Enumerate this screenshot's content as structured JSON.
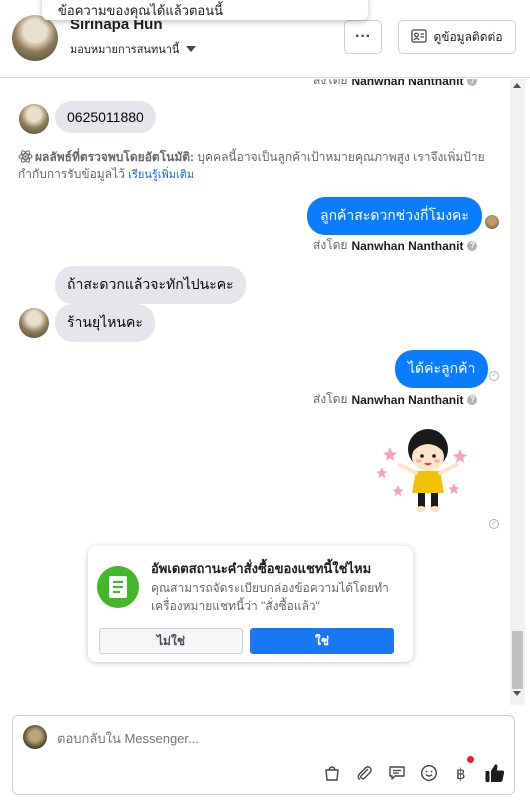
{
  "toast": {
    "text": "ข้อความของคุณได้แล้วตอนนี้"
  },
  "header": {
    "name": "Sirinapa Hun",
    "assign_label": "มอบหมายการสนทนานี้",
    "more_label": "···",
    "contact_button_label": "ดูข้อมูลติดต่อ"
  },
  "messages": {
    "top_sent_by": {
      "prefix": "ส่งโดย",
      "name": "Nanwhan Nanthanit"
    },
    "msg_phone": "0625011880",
    "auto_detect": {
      "label": "ผลลัพธ์ที่ตรวจพบโดยอัตโนมัติ:",
      "text": "บุคคลนี้อาจเป็นลูกค้าเป้าหมายคุณภาพสูง เราจึงเพิ่มป้ายกำกับการรับข้อมูลไว้",
      "link": "เรียนรู้เพิ่มเติม"
    },
    "msg_out_1": "ลูกค้าสะดวกช่วงกี่โมงคะ",
    "sent_by_1": {
      "prefix": "ส่งโดย",
      "name": "Nanwhan Nanthanit"
    },
    "msg_in_2": "ถ้าสะดวกแล้วจะทักไปนะคะ",
    "msg_in_3": "ร้านยุไหนคะ",
    "msg_out_2": "ได้ค่ะลูกค้า",
    "sent_by_2": {
      "prefix": "ส่งโดย",
      "name": "Nanwhan Nanthanit"
    }
  },
  "order_card": {
    "title": "อัพเดตสถานะคำสั่งซื้อของแชทนี้ใช่ไหม",
    "description": "คุณสามารถจัดระเบียบกล่องข้อความได้โดยทำเครื่องหมายแชทนี้ว่า \"สั่งซื้อแล้ว\"",
    "no_label": "ไม่ใช่",
    "yes_label": "ใช่"
  },
  "composer": {
    "placeholder": "ตอบกลับใน Messenger..."
  },
  "colors": {
    "accent": "#0a7cff",
    "button_blue": "#1877f2",
    "success_green": "#42b72a",
    "bubble_in": "#e4e6eb"
  }
}
